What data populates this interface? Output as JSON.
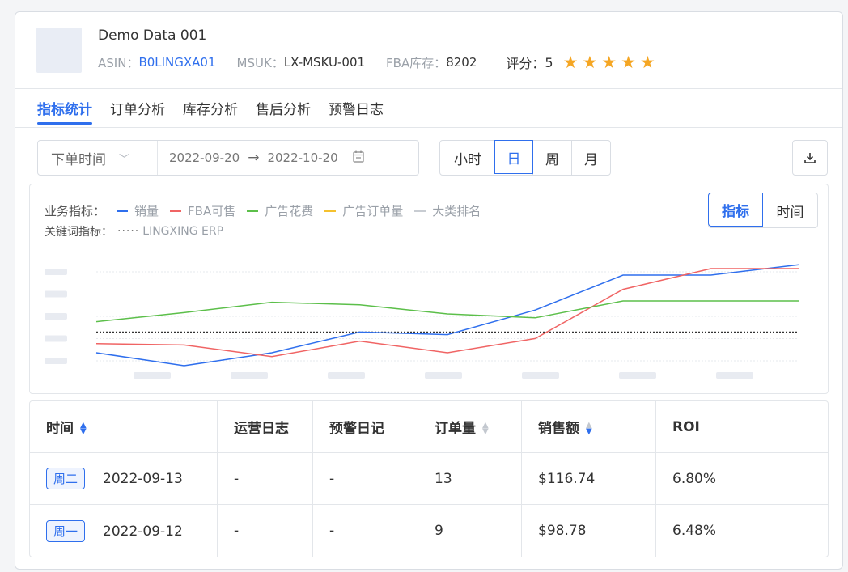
{
  "header": {
    "title": "Demo Data 001",
    "asin_label": "ASIN：",
    "asin_value": "B0LINGXA01",
    "msku_label": "MSUK：",
    "msku_value": "LX-MSKU-001",
    "fba_label": "FBA库存：",
    "fba_value": "8202",
    "score_label": "评分：",
    "score_value": "5",
    "stars": 5
  },
  "tabs": [
    "指标统计",
    "订单分析",
    "库存分析",
    "售后分析",
    "预警日志"
  ],
  "filter": {
    "type_label": "下单时间",
    "start_date": "2022-09-20",
    "arrow": "→",
    "end_date": "2022-10-20",
    "granularity": [
      "小时",
      "日",
      "周",
      "月"
    ],
    "active_granularity": "日"
  },
  "chart_panel": {
    "metric_label": "业务指标：",
    "keyword_label": "关键词指标：",
    "keyword_dots": "·····",
    "keyword_name": "LINGXING ERP",
    "toggle": [
      "指标",
      "时间"
    ],
    "active_toggle": "指标"
  },
  "chart_data": {
    "type": "line",
    "x": [
      1,
      2,
      3,
      4,
      5,
      6,
      7,
      8,
      9,
      10,
      11,
      12
    ],
    "ylim": [
      0,
      100
    ],
    "grid": true,
    "series": [
      {
        "name": "销量",
        "color": "#2f6fed",
        "values": [
          20,
          10,
          20,
          36,
          34,
          53,
          80,
          80,
          88
        ]
      },
      {
        "name": "FBA可售",
        "color": "#f06464",
        "values": [
          27,
          26,
          17,
          29,
          20,
          31,
          69,
          85,
          85
        ]
      },
      {
        "name": "广告花费",
        "color": "#5cbf4a",
        "values": [
          44,
          51,
          59,
          57,
          50,
          47,
          60,
          60,
          60
        ]
      },
      {
        "name": "广告订单量",
        "color": "#f5c12e",
        "values": []
      },
      {
        "name": "大类排名",
        "color": "#c8ccd2",
        "values": []
      }
    ],
    "keyword_series": {
      "name": "LINGXING ERP",
      "values": [
        36,
        36,
        36,
        36,
        36,
        36,
        36,
        36,
        36
      ]
    }
  },
  "table": {
    "columns": [
      "时间",
      "运营日志",
      "预警日记",
      "订单量",
      "销售额",
      "ROI"
    ],
    "rows": [
      {
        "day": "周二",
        "date": "2022-09-13",
        "log": "-",
        "warn": "-",
        "orders": "13",
        "sales": "$116.74",
        "roi": "6.80%"
      },
      {
        "day": "周一",
        "date": "2022-09-12",
        "log": "-",
        "warn": "-",
        "orders": "9",
        "sales": "$98.78",
        "roi": "6.48%"
      }
    ]
  }
}
